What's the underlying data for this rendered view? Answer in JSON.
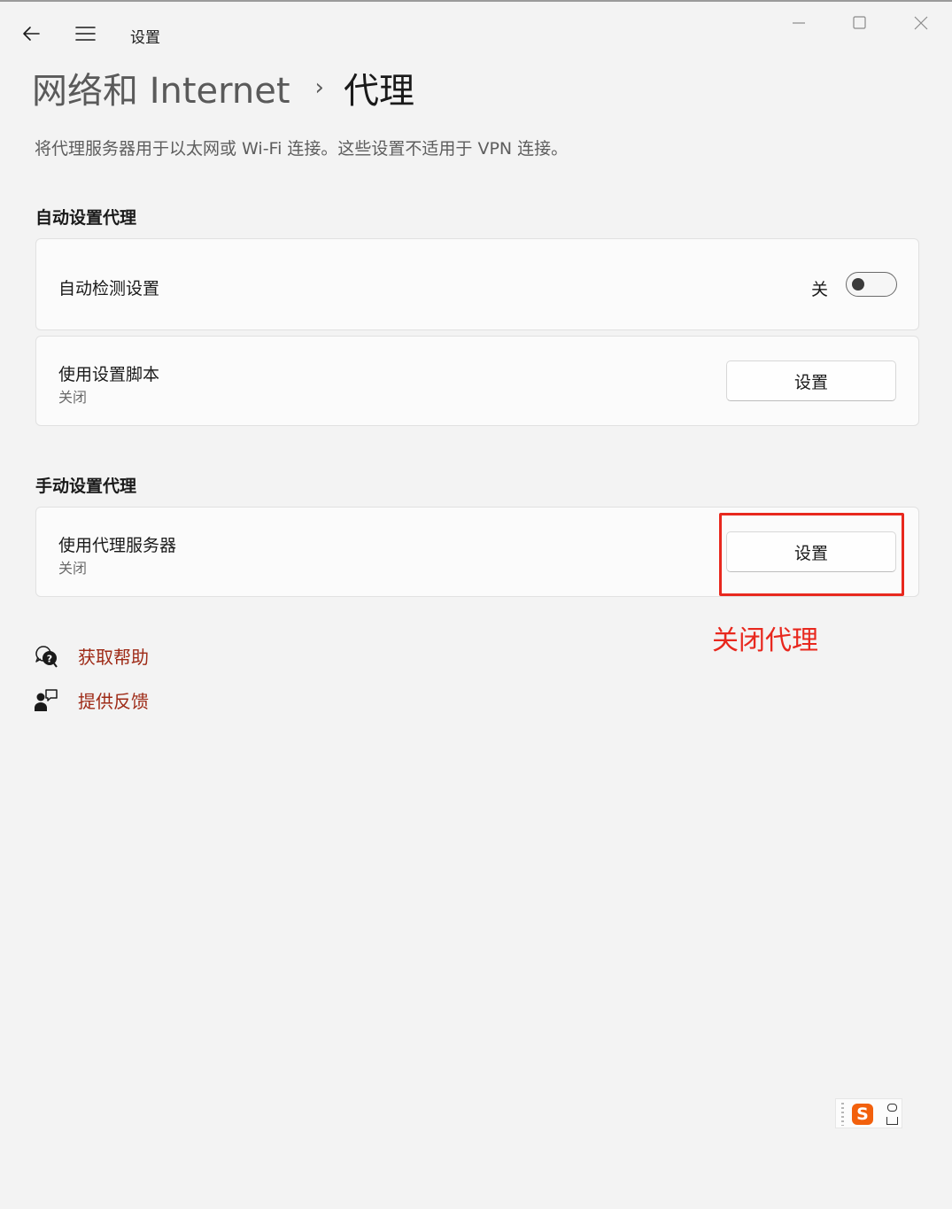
{
  "window": {
    "title": "设置"
  },
  "breadcrumb": {
    "parent": "网络和 Internet",
    "separator": "›",
    "current": "代理"
  },
  "description": "将代理服务器用于以太网或 Wi-Fi 连接。这些设置不适用于 VPN 连接。",
  "auto_section": {
    "title": "自动设置代理",
    "detect": {
      "label": "自动检测设置",
      "toggle_text": "关",
      "toggle_on": false
    },
    "script": {
      "label": "使用设置脚本",
      "status": "关闭",
      "button": "设置"
    }
  },
  "manual_section": {
    "title": "手动设置代理",
    "proxy": {
      "label": "使用代理服务器",
      "status": "关闭",
      "button": "设置"
    }
  },
  "annotation": {
    "text": "关闭代理",
    "color": "#e8281e"
  },
  "links": [
    {
      "label": "获取帮助",
      "icon": "help-chat-icon"
    },
    {
      "label": "提供反馈",
      "icon": "feedback-icon"
    }
  ],
  "ime": {
    "logo": "S"
  },
  "colors": {
    "link": "#9e2a16",
    "background": "#f3f3f3",
    "card": "#fbfbfb"
  }
}
